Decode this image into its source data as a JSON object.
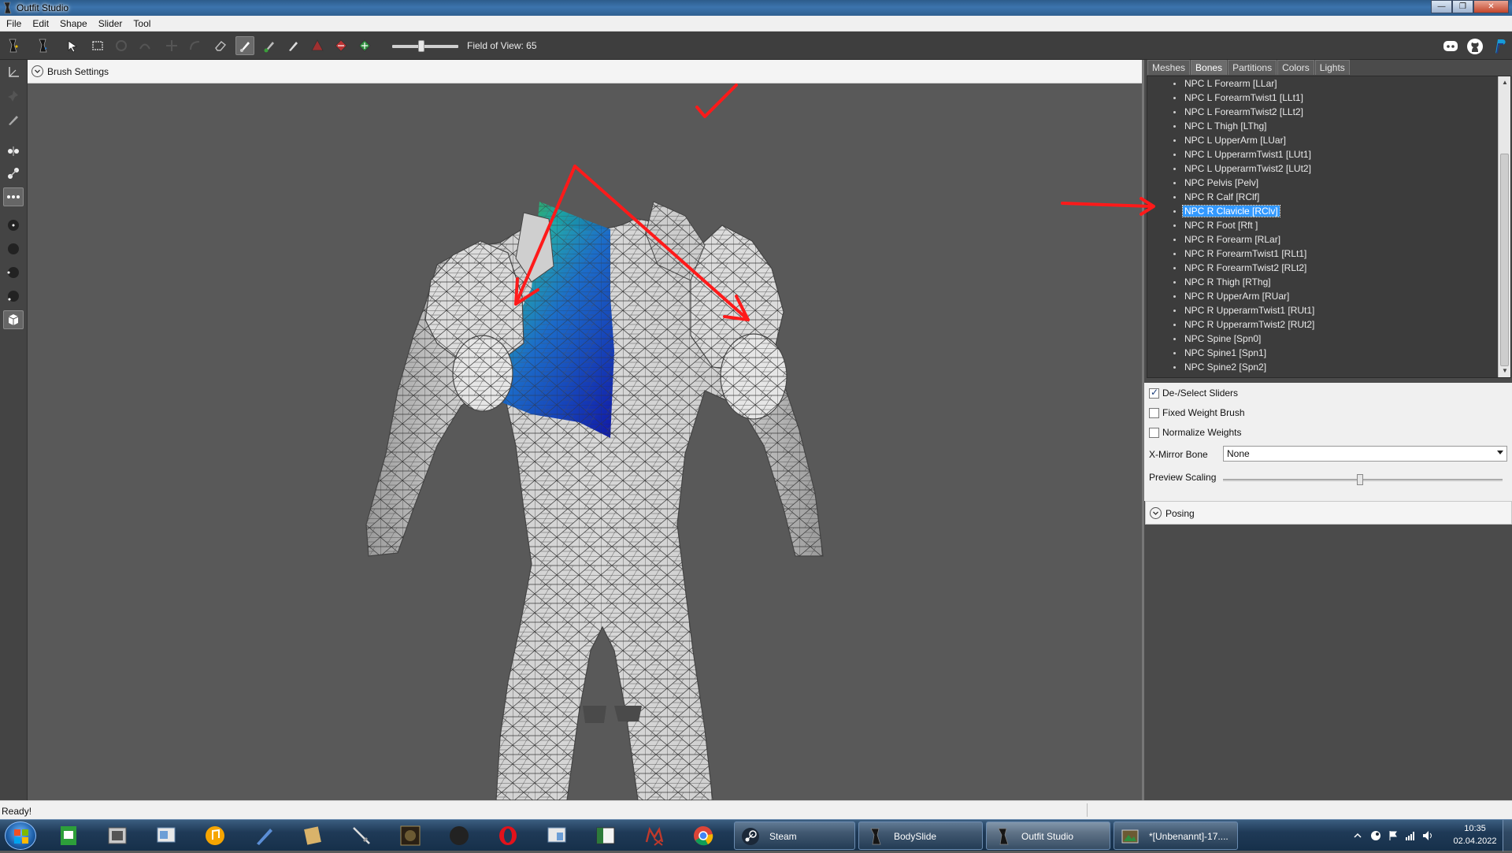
{
  "window": {
    "title": "Outfit Studio"
  },
  "menu": [
    "File",
    "Edit",
    "Shape",
    "Slider",
    "Tool"
  ],
  "toolbar": {
    "field_of_view_label": "Field of View: 65",
    "field_of_view": 65,
    "icons": [
      "select-icon",
      "transform-icon",
      "mask-brush-icon",
      "inflate-brush-icon",
      "deflate-brush-icon",
      "move-brush-icon",
      "smooth-brush-icon",
      "undiff-brush-icon",
      "weight-brush-icon",
      "color-brush-icon",
      "alpha-brush-icon",
      "collision-icon",
      "mirror-icon",
      "symmetry-icon"
    ],
    "right_icons": [
      "discord-icon",
      "github-icon",
      "paypal-icon"
    ]
  },
  "brush_settings": {
    "label": "Brush Settings"
  },
  "panel": {
    "tabs": [
      "Meshes",
      "Bones",
      "Partitions",
      "Colors",
      "Lights"
    ],
    "active_tab": "Bones",
    "bones": [
      "NPC L Forearm [LLar]",
      "NPC L ForearmTwist1 [LLt1]",
      "NPC L ForearmTwist2 [LLt2]",
      "NPC L Thigh [LThg]",
      "NPC L UpperArm [LUar]",
      "NPC L UpperarmTwist1 [LUt1]",
      "NPC L UpperarmTwist2 [LUt2]",
      "NPC Pelvis [Pelv]",
      "NPC R Calf [RClf]",
      "NPC R Clavicle [RClv]",
      "NPC R Foot [Rft ]",
      "NPC R Forearm [RLar]",
      "NPC R ForearmTwist1 [RLt1]",
      "NPC R ForearmTwist2 [RLt2]",
      "NPC R Thigh [RThg]",
      "NPC R UpperArm [RUar]",
      "NPC R UpperarmTwist1 [RUt1]",
      "NPC R UpperarmTwist2 [RUt2]",
      "NPC Spine [Spn0]",
      "NPC Spine1 [Spn1]",
      "NPC Spine2 [Spn2]"
    ],
    "selected_bone": "NPC R Clavicle [RClv]",
    "options": {
      "deselect_sliders": "De-/Select Sliders",
      "deselect_sliders_checked": true,
      "fixed_weight_brush": "Fixed Weight Brush",
      "fixed_weight_brush_checked": false,
      "normalize_weights": "Normalize Weights",
      "normalize_weights_checked": false,
      "xmirror_label": "X-Mirror Bone",
      "xmirror_value": "None",
      "preview_scaling_label": "Preview Scaling",
      "preview_scaling": 0.5
    },
    "posing": {
      "label": "Posing"
    }
  },
  "status": {
    "text": "Ready!"
  },
  "taskbar": {
    "tasks": [
      {
        "label": "Steam",
        "icon": "steam-icon"
      },
      {
        "label": "BodySlide",
        "icon": "bodyslide-icon"
      },
      {
        "label": "Outfit Studio",
        "icon": "outfit-studio-icon",
        "active": true
      },
      {
        "label": "*[Unbenannt]-17....",
        "icon": "image-editor-icon"
      }
    ],
    "pinned": [
      "file-manager-icon",
      "media-icon",
      "explorer-icon",
      "music-icon",
      "pen-icon",
      "scroll-icon",
      "sword-icon",
      "game-icon",
      "obs-icon",
      "opera-icon",
      "explorer-2-icon",
      "window-icon",
      "mx-icon",
      "chrome-icon"
    ],
    "clock_time": "10:35",
    "clock_date": "02.04.2022"
  },
  "colors": {
    "accent_selection": "#3399ff",
    "annotation": "#ff1a1a",
    "weight_high": "#0a1fa8",
    "weight_mid": "#1aa0b8",
    "weight_low": "#43c43c"
  }
}
